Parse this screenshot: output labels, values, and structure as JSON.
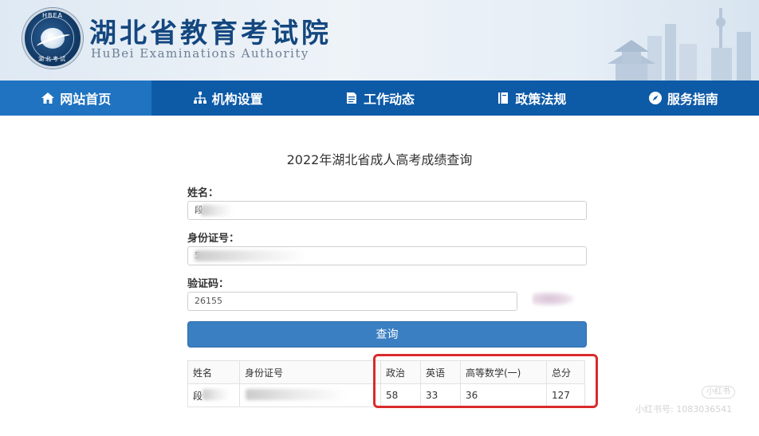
{
  "header": {
    "org_name_cn": "湖北省教育考试院",
    "org_name_en": "HuBei Examinations Authority",
    "logo_top_text": "HBEA",
    "logo_bottom_text": "湖北考试"
  },
  "nav": {
    "items": [
      {
        "label": "网站首页",
        "icon": "home-icon",
        "active": true
      },
      {
        "label": "机构设置",
        "icon": "org-chart-icon",
        "active": false
      },
      {
        "label": "工作动态",
        "icon": "document-icon",
        "active": false
      },
      {
        "label": "政策法规",
        "icon": "book-icon",
        "active": false
      },
      {
        "label": "服务指南",
        "icon": "compass-icon",
        "active": false
      }
    ]
  },
  "form": {
    "title": "2022年湖北省成人高考成绩查询",
    "name_label": "姓名：",
    "name_value": "段",
    "id_label": "身份证号：",
    "id_value": "5",
    "captcha_label": "验证码：",
    "captcha_value": "26155",
    "submit_label": "查询"
  },
  "results": {
    "headers": [
      "姓名",
      "身份证号",
      "政治",
      "英语",
      "高等数学(一)",
      "总分"
    ],
    "row": {
      "name": "段",
      "id": "",
      "politics": "58",
      "english": "33",
      "math": "36",
      "total": "127"
    }
  },
  "watermark": {
    "badge": "小红书",
    "text": "小红书号: 1083036541"
  },
  "colors": {
    "nav_bg": "#0d5aa7",
    "nav_active": "#1f73c0",
    "button": "#3a7fc2",
    "highlight": "#d92b2b",
    "title_blue": "#14477f"
  }
}
